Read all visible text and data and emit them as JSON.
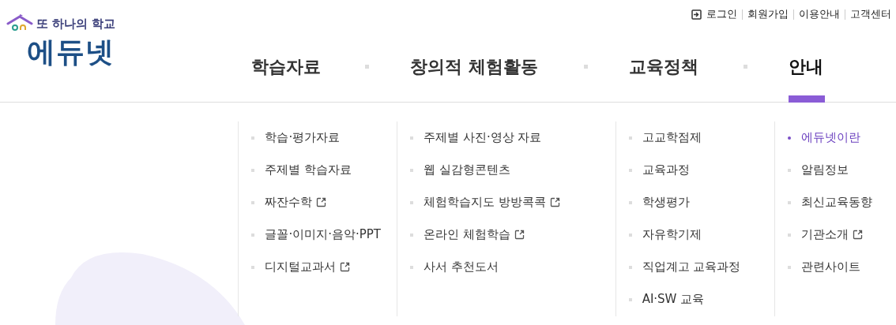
{
  "logo": {
    "tagline": "또 하나의 학교",
    "name": "에듀넷"
  },
  "utility_links": [
    {
      "label": "로그인",
      "kind": "login"
    },
    {
      "label": "회원가입",
      "kind": "link"
    },
    {
      "label": "이용안내",
      "kind": "link"
    },
    {
      "label": "고객센터",
      "kind": "link"
    }
  ],
  "menu": [
    {
      "label": "학습자료",
      "selected": false,
      "items": [
        {
          "label": "학습·평가자료",
          "selected": false,
          "external": false
        },
        {
          "label": "주제별 학습자료",
          "selected": false,
          "external": false
        },
        {
          "label": "짜잔수학",
          "selected": false,
          "external": true
        },
        {
          "label": "글꼴·이미지·음악·PPT",
          "selected": false,
          "external": false
        },
        {
          "label": "디지털교과서",
          "selected": false,
          "external": true
        }
      ]
    },
    {
      "label": "창의적 체험활동",
      "selected": false,
      "items": [
        {
          "label": "주제별 사진·영상 자료",
          "selected": false,
          "external": false
        },
        {
          "label": "웹 실감형콘텐츠",
          "selected": false,
          "external": false
        },
        {
          "label": "체험학습지도 방방콕콕",
          "selected": false,
          "external": true
        },
        {
          "label": "온라인 체험학습",
          "selected": false,
          "external": true
        },
        {
          "label": "사서 추천도서",
          "selected": false,
          "external": false
        }
      ]
    },
    {
      "label": "교육정책",
      "selected": false,
      "items": [
        {
          "label": "고교학점제",
          "selected": false,
          "external": false
        },
        {
          "label": "교육과정",
          "selected": false,
          "external": false
        },
        {
          "label": "학생평가",
          "selected": false,
          "external": false
        },
        {
          "label": "자유학기제",
          "selected": false,
          "external": false
        },
        {
          "label": "직업계고 교육과정",
          "selected": false,
          "external": false
        },
        {
          "label": "AI·SW 교육",
          "selected": false,
          "external": false
        }
      ]
    },
    {
      "label": "안내",
      "selected": true,
      "items": [
        {
          "label": "에듀넷이란",
          "selected": true,
          "external": false
        },
        {
          "label": "알림정보",
          "selected": false,
          "external": false
        },
        {
          "label": "최신교육동향",
          "selected": false,
          "external": false
        },
        {
          "label": "기관소개",
          "selected": false,
          "external": true
        },
        {
          "label": "관련사이트",
          "selected": false,
          "external": false
        }
      ]
    }
  ]
}
